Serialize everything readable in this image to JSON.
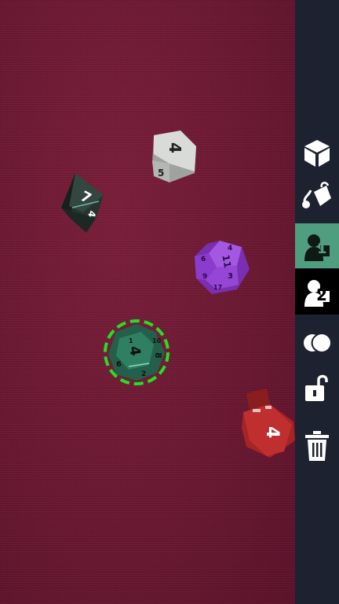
{
  "table": {
    "felt_color": "#6b1a32",
    "dice": [
      {
        "type": "d8",
        "color": "#2b3a36",
        "top_face": "7",
        "side_face": "4"
      },
      {
        "type": "d6",
        "color": "#c9ccc9",
        "top_face": "4",
        "side_face": "5"
      },
      {
        "type": "d12",
        "color": "#8e3fc9",
        "faces": [
          "11",
          "4",
          "3",
          "9",
          "6",
          "17"
        ]
      },
      {
        "type": "d12",
        "color": "#2f7f62",
        "selected": true,
        "faces": [
          "4",
          "8",
          "6",
          "2",
          "1",
          "10"
        ]
      },
      {
        "type": "d6",
        "color": "#b02a2a",
        "top_face": "4"
      }
    ],
    "selection_color": "#22e022"
  },
  "sidebar": {
    "background": "#1d2230",
    "tools": [
      {
        "icon": "cube-icon",
        "active": false
      },
      {
        "icon": "paint-bucket-icon",
        "active": false
      },
      {
        "icon": "player-1-icon",
        "label": "1",
        "active": true
      },
      {
        "icon": "player-2-icon",
        "label": "2",
        "active": false
      },
      {
        "icon": "moon-icon",
        "active": false
      },
      {
        "icon": "unlock-icon",
        "active": false
      },
      {
        "icon": "trash-icon",
        "active": false
      }
    ]
  }
}
